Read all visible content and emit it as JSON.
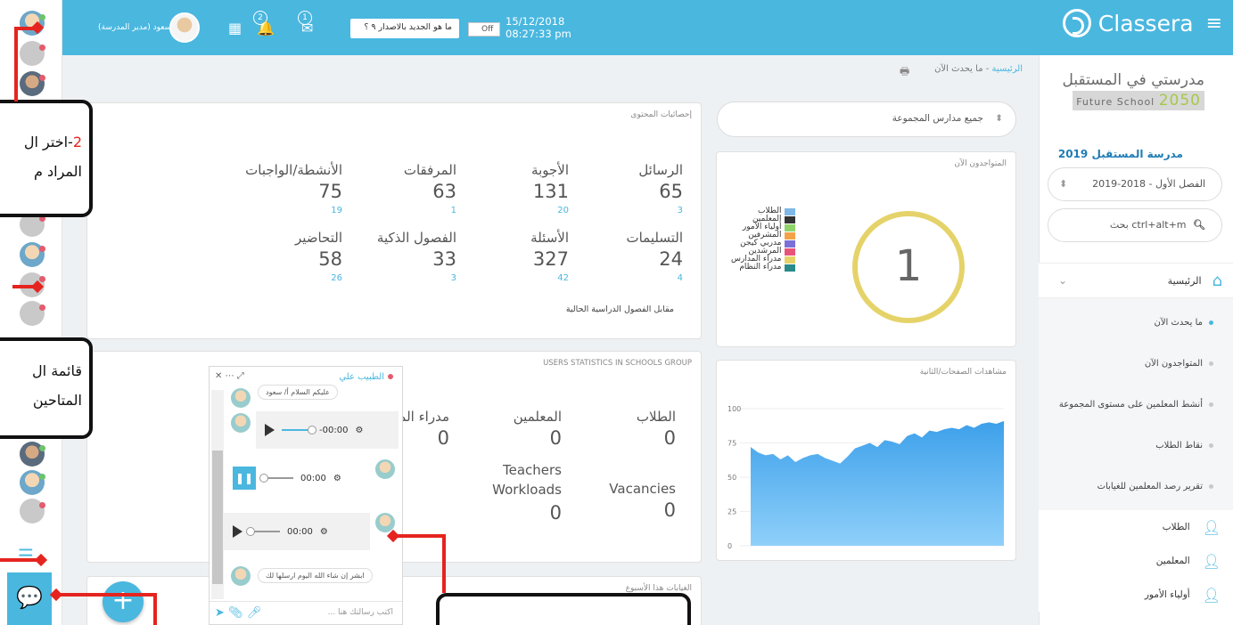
{
  "topbar": {
    "brand": "Classera",
    "datetime_date": "15/12/2018",
    "datetime_time": "08:27:33 pm",
    "toggle_label": "Off",
    "whats_new": "ما هو الجديد بالاصدار ٩ ؟",
    "notifications_count": "2",
    "messages_count": "1",
    "user_name": "سعود (مدير المدرسة)"
  },
  "sidebar": {
    "school_logo_line1": "مدرستي في المستقبل",
    "school_logo_line2": "Future School",
    "school_logo_year": "2050",
    "school_name": "مدرسة المستقبل 2019",
    "semester": "الفصل الأول - 2018-2019",
    "search_placeholder": "ctrl+alt+m بحث",
    "home_label": "الرئيسية",
    "submenu": [
      "ما يحدث الآن",
      "المتواجدون الآن",
      "أنشط المعلمين على مستوى المجموعة",
      "نقاط الطلاب",
      "تقرير رصد المعلمين للغيابات"
    ],
    "main_items": [
      "الطلاب",
      "المعلمين",
      "أولياء الأمور"
    ]
  },
  "breadcrumb": {
    "home": "الرئيسية",
    "current": "ما يحدث الآن"
  },
  "content_stats": {
    "title": "إحصائيات المحتوى",
    "items": [
      {
        "label": "الرسائل",
        "value": "65",
        "sub": "3"
      },
      {
        "label": "الأجوبة",
        "value": "131",
        "sub": "20"
      },
      {
        "label": "المرفقات",
        "value": "63",
        "sub": "1"
      },
      {
        "label": "الأنشطة/الواجبات",
        "value": "75",
        "sub": "19"
      },
      {
        "label": "التسليمات",
        "value": "24",
        "sub": "4"
      },
      {
        "label": "الأسئلة",
        "value": "327",
        "sub": "42"
      },
      {
        "label": "الفصول الذكية",
        "value": "33",
        "sub": "3"
      },
      {
        "label": "التحاضير",
        "value": "58",
        "sub": "26"
      }
    ],
    "compare_label": "مقابل الفصول الدراسية الحالية"
  },
  "school_select": "جميع مدارس المجموعة",
  "online_now": {
    "title": "المتواجدون الآن",
    "count": "1",
    "legend": [
      {
        "label": "الطلاب",
        "color": "#7fb8e6"
      },
      {
        "label": "المعلمين",
        "color": "#333333"
      },
      {
        "label": "أولياء الأمور",
        "color": "#8fd46b"
      },
      {
        "label": "المشرفين",
        "color": "#f3a24a"
      },
      {
        "label": "مدربي كيجن",
        "color": "#7d6fd8"
      },
      {
        "label": "المرشدين",
        "color": "#e8537a"
      },
      {
        "label": "مدراء المدارس",
        "color": "#e5d36a"
      },
      {
        "label": "مدراء النظام",
        "color": "#2a8a8a"
      }
    ]
  },
  "page_views": {
    "title": "مشاهدات الصفحات/الثانية",
    "y_ticks": [
      "100",
      "75",
      "50",
      "25",
      "0"
    ]
  },
  "chart_data": {
    "type": "area",
    "title": "مشاهدات الصفحات/الثانية",
    "ylim": [
      0,
      100
    ],
    "y_ticks": [
      0,
      25,
      50,
      75,
      100
    ],
    "values": [
      72,
      68,
      66,
      67,
      63,
      66,
      61,
      64,
      66,
      67,
      64,
      62,
      60,
      65,
      71,
      73,
      75,
      72,
      77,
      76,
      74,
      80,
      82,
      79,
      84,
      83,
      85,
      86,
      85,
      88,
      86,
      89,
      90,
      89,
      91
    ]
  },
  "users_stats": {
    "title": "USERS STATISTICS IN SCHOOLS GROUP",
    "items": [
      {
        "label": "الطلاب",
        "value": "0"
      },
      {
        "label": "المعلمين",
        "value": "0"
      },
      {
        "label": "مدراء المدارس",
        "value": "0"
      }
    ],
    "vacancies_label": "Vacancies",
    "vacancies_value": "0",
    "workloads_label": "Teachers Workloads",
    "workloads_value": "0"
  },
  "absence": {
    "title": "الغيابات هذا الأسبوع"
  },
  "chat": {
    "contact": "الطبيب علي",
    "msg1": "عليكم السلام أ/ سعود",
    "audio1_time": "-00:00",
    "audio2_time": "00:00",
    "audio3_time": "00:00",
    "msg2": "ابشر إن شاء الله اليوم ارسلها لك",
    "input_placeholder": "اكتب رسالتك هنا ..."
  },
  "annotations": {
    "callout1_num": "2",
    "callout1_line1": "-اختر ال",
    "callout1_line2": "المراد م",
    "callout2_line1": "قائمة ال",
    "callout2_line2": "المتاحين"
  },
  "colors": {
    "accent": "#4ab7df",
    "annotation_red": "#e5241f"
  }
}
